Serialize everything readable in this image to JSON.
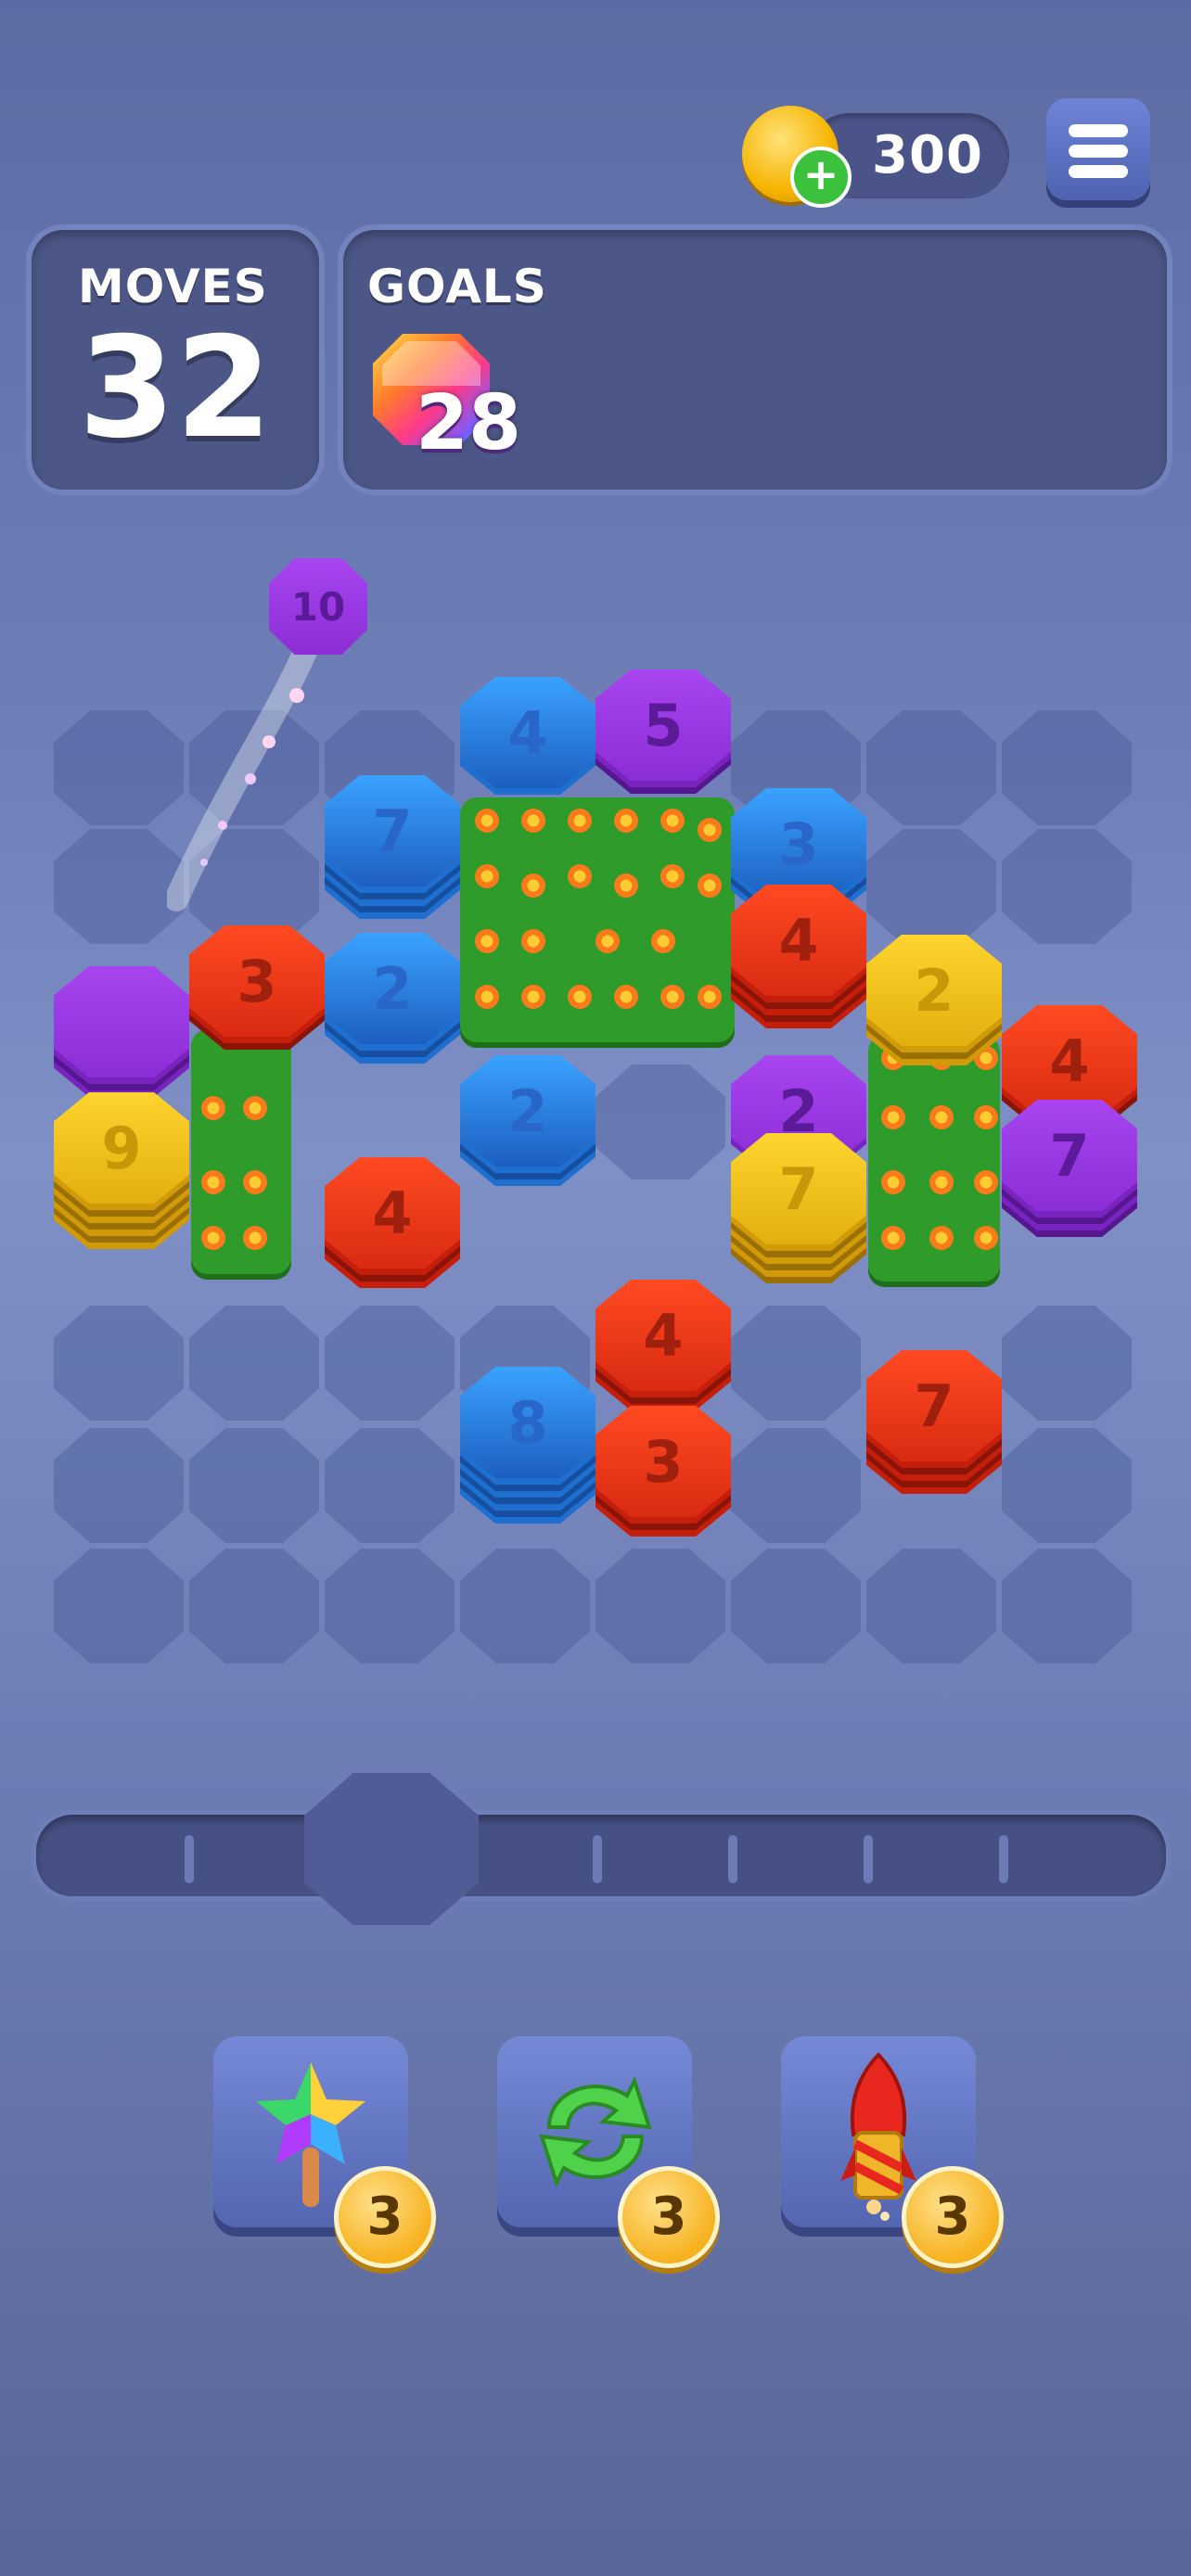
{
  "hud": {
    "coins": "300",
    "coin_plus": "+",
    "moves_label": "MOVES",
    "moves_value": "32",
    "goals_label": "GOALS",
    "goal_count": "28"
  },
  "colors": {
    "blue": "#2f8ff0",
    "purple": "#9b2ee6",
    "red": "#e83214",
    "yellow": "#f4c212",
    "green": "#2f9b2b"
  },
  "board": {
    "floating_tile": {
      "color": "purple",
      "count": "10"
    },
    "tiles": [
      {
        "id": "t1",
        "color": "blue",
        "count": "4"
      },
      {
        "id": "t2",
        "color": "purple",
        "count": "5"
      },
      {
        "id": "t3",
        "color": "blue",
        "count": "7"
      },
      {
        "id": "t4",
        "color": "blue",
        "count": "3"
      },
      {
        "id": "t5",
        "color": "red",
        "count": "3"
      },
      {
        "id": "t6",
        "color": "blue",
        "count": "2"
      },
      {
        "id": "t7",
        "color": "red",
        "count": "4"
      },
      {
        "id": "t8",
        "color": "yellow",
        "count": "2"
      },
      {
        "id": "t9",
        "color": "red",
        "count": "4"
      },
      {
        "id": "t10",
        "color": "purple",
        "count": ""
      },
      {
        "id": "t11",
        "color": "blue",
        "count": "2"
      },
      {
        "id": "t12",
        "color": "purple",
        "count": "2"
      },
      {
        "id": "t13",
        "color": "purple",
        "count": "7"
      },
      {
        "id": "t14",
        "color": "yellow",
        "count": "9"
      },
      {
        "id": "t15",
        "color": "red",
        "count": "4"
      },
      {
        "id": "t16",
        "color": "yellow",
        "count": "7"
      },
      {
        "id": "t17",
        "color": "red",
        "count": "4"
      },
      {
        "id": "t18",
        "color": "red",
        "count": "7"
      },
      {
        "id": "t19",
        "color": "blue",
        "count": "8"
      },
      {
        "id": "t20",
        "color": "red",
        "count": "3"
      }
    ]
  },
  "powerups": [
    {
      "name": "rainbow-star-hammer",
      "count": "3"
    },
    {
      "name": "shuffle",
      "count": "3"
    },
    {
      "name": "rocket",
      "count": "3"
    }
  ]
}
